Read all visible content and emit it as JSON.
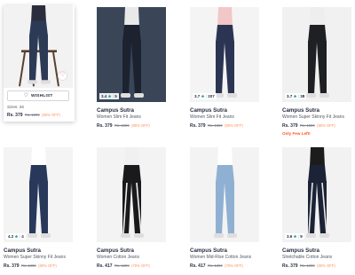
{
  "products": [
    {
      "brand": "",
      "name": "",
      "rating": "",
      "reviews": "",
      "price": "Rs. 379",
      "mrp": "Rs. 1899",
      "discount": "(80% OFF)",
      "hover": true,
      "wishlist_label": "WISHLIST",
      "sizes_label": "Sizes: 26",
      "jeans_color": "#2c3a55"
    },
    {
      "brand": "Campus Sutra",
      "name": "Women Slim Fit Jeans",
      "rating": "3.4",
      "reviews": "5",
      "price": "Rs. 379",
      "mrp": "Rs. 1899",
      "discount": "(80% OFF)",
      "jeans_color": "#1d2230"
    },
    {
      "brand": "Campus Sutra",
      "name": "Women Slim Fit Jeans",
      "rating": "3.7",
      "reviews": "207",
      "price": "Rs. 379",
      "mrp": "Rs. 1899",
      "discount": "(80% OFF)",
      "jeans_color": "#2b3553"
    },
    {
      "brand": "Campus Sutra",
      "name": "Women Super Skinny Fit Jeans",
      "rating": "3.7",
      "reviews": "38",
      "price": "Rs. 379",
      "mrp": "Rs. 1899",
      "discount": "(80% OFF)",
      "few_left": "Only Few Left!",
      "jeans_color": "#1f2024"
    },
    {
      "brand": "Campus Sutra",
      "name": "Women Super Skinny Fit Jeans",
      "rating": "4.2",
      "reviews": "4",
      "price": "Rs. 379",
      "mrp": "Rs. 1899",
      "discount": "(80% OFF)",
      "jeans_color": "#28385a"
    },
    {
      "brand": "Campus Sutra",
      "name": "Women Cotton Jeans",
      "rating": "",
      "reviews": "",
      "price": "Rs. 417",
      "mrp": "Rs. 1399",
      "discount": "(70% OFF)",
      "jeans_color": "#1a1a1c",
      "stripe": "#f0f0f0"
    },
    {
      "brand": "Campus Sutra",
      "name": "Women Mid-Rise Cotton Jeans",
      "rating": "",
      "reviews": "",
      "price": "Rs. 417",
      "mrp": "Rs. 1399",
      "discount": "(70% OFF)",
      "jeans_color": "#8fb0d2"
    },
    {
      "brand": "Campus Sutra",
      "name": "Stretchable Cotton Jeans",
      "rating": "3.6",
      "reviews": "9",
      "price": "Rs. 379",
      "mrp": "Rs. 1899",
      "discount": "(80% OFF)",
      "jeans_color": "#1c2336",
      "stripe": "#e8e8e8"
    }
  ],
  "colors": {
    "rating_star": "#14958f",
    "discount": "#ff905a",
    "few_left": "#ff5722",
    "wishlist_heart": "#ff3f6c"
  }
}
